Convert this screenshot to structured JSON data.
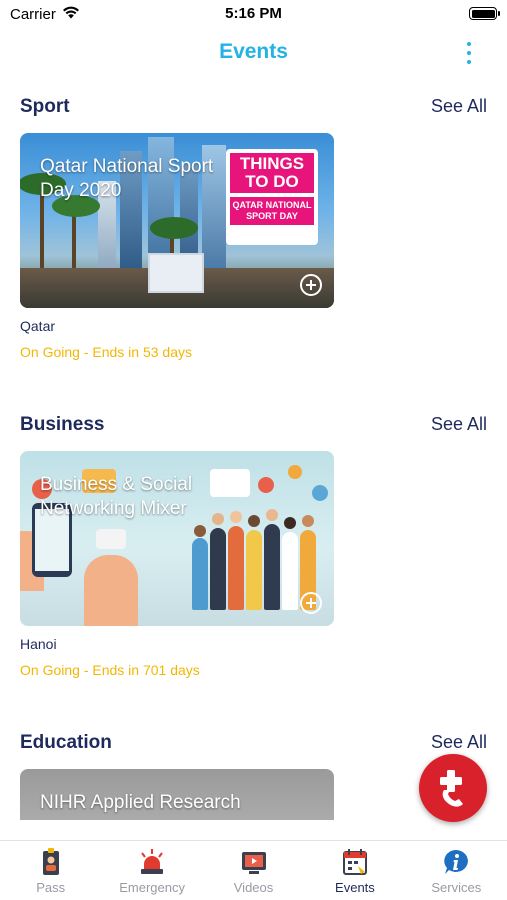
{
  "status_bar": {
    "carrier": "Carrier",
    "time": "5:16 PM"
  },
  "nav": {
    "title": "Events",
    "more_icon": "vertical-ellipsis-icon"
  },
  "sections": [
    {
      "title": "Sport",
      "see_all": "See All",
      "card": {
        "title": "Qatar National Sport Day 2020",
        "sign_top": "THINGS TO DO",
        "sign_bottom": "QATAR NATIONAL SPORT DAY",
        "location": "Qatar",
        "status": "On Going - Ends in 53 days"
      }
    },
    {
      "title": "Business",
      "see_all": "See All",
      "card": {
        "title": "Business & Social Networking Mixer",
        "location": "Hanoi",
        "status": "On Going - Ends in 701 days"
      }
    },
    {
      "title": "Education",
      "see_all": "See All",
      "card": {
        "title": "NIHR Applied Research"
      }
    }
  ],
  "fab": {
    "icon": "emergency-call-icon",
    "color": "#d8212a"
  },
  "tabs": [
    {
      "label": "Pass",
      "icon": "id-badge-icon"
    },
    {
      "label": "Emergency",
      "icon": "siren-icon"
    },
    {
      "label": "Videos",
      "icon": "video-icon"
    },
    {
      "label": "Events",
      "icon": "calendar-icon",
      "active": true
    },
    {
      "label": "Services",
      "icon": "info-icon"
    }
  ],
  "colors": {
    "accent": "#22b3e3",
    "heading": "#1f2a5c",
    "status_ongoing": "#f2b705",
    "tab_inactive": "#9a9aa3"
  }
}
